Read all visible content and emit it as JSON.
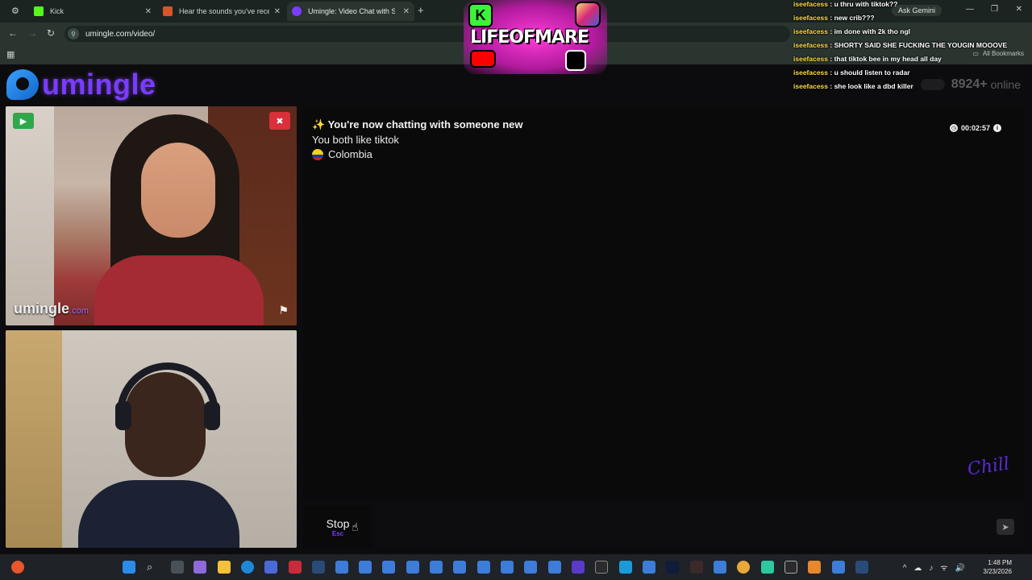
{
  "browser": {
    "tabs": [
      {
        "label": "Kick",
        "color": "#53fc18"
      },
      {
        "label": "Hear the sounds you've recently...",
        "color": "#d9542b"
      },
      {
        "label": "Umingle: Video Chat with Str",
        "color": "#7a3cff"
      }
    ],
    "url": "umingle.com/video/",
    "ask_gemini": "Ask Gemini",
    "all_bookmarks": "All Bookmarks"
  },
  "site": {
    "logo": "umingle",
    "online_count": "8924+",
    "online_label": "online"
  },
  "video": {
    "watermark_name": "umingle",
    "watermark_domain": ".com"
  },
  "chat": {
    "intro": "✨ You're now chatting with someone new",
    "common": "You both like tiktok",
    "country": "Colombia",
    "timer": "00:02:57"
  },
  "controls": {
    "stop_label": "Stop",
    "stop_key": "Esc"
  },
  "overlay": {
    "stream_logo_text": "LIFEOFMARE",
    "messages": [
      {
        "user": "iseefacess",
        "text": " : u thru with tiktok??"
      },
      {
        "user": "iseefacess",
        "text": " : new crib???"
      },
      {
        "user": "iseefacess",
        "text": " : im done with 2k tho ngl"
      },
      {
        "user": "iseefacess",
        "text": " : SHORTY SAID SHE FUCKING THE YOUGIN MOOOVE"
      },
      {
        "user": "iseefacess",
        "text": " : that tiktok bee in my head all day"
      },
      {
        "user": "iseefacess",
        "text": " : u should listen to radar"
      },
      {
        "user": "iseefacess",
        "text": " : she look like a dbd killer"
      }
    ]
  },
  "taskbar": {
    "time": "1:48 PM",
    "date": "3/23/2026"
  }
}
